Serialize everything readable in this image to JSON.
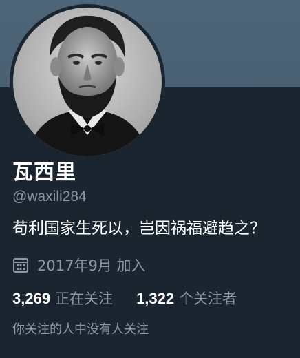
{
  "profile": {
    "display_name": "瓦西里",
    "handle": "@waxili284",
    "bio": "苟利国家生死以，岂因祸福避趋之？",
    "joined": "2017年9月 加入",
    "following_count": "3,269",
    "following_label": "正在关注",
    "followers_count": "1,322",
    "followers_label": "个关注者",
    "mutual_note": "你关注的人中没有人关注"
  },
  "icons": {
    "avatar": "avatar-portrait",
    "joined": "calendar-icon"
  },
  "colors": {
    "background": "#1b2530",
    "banner": "#4e6679",
    "secondary_text": "#8b98a5",
    "primary_text": "#ffffff"
  }
}
